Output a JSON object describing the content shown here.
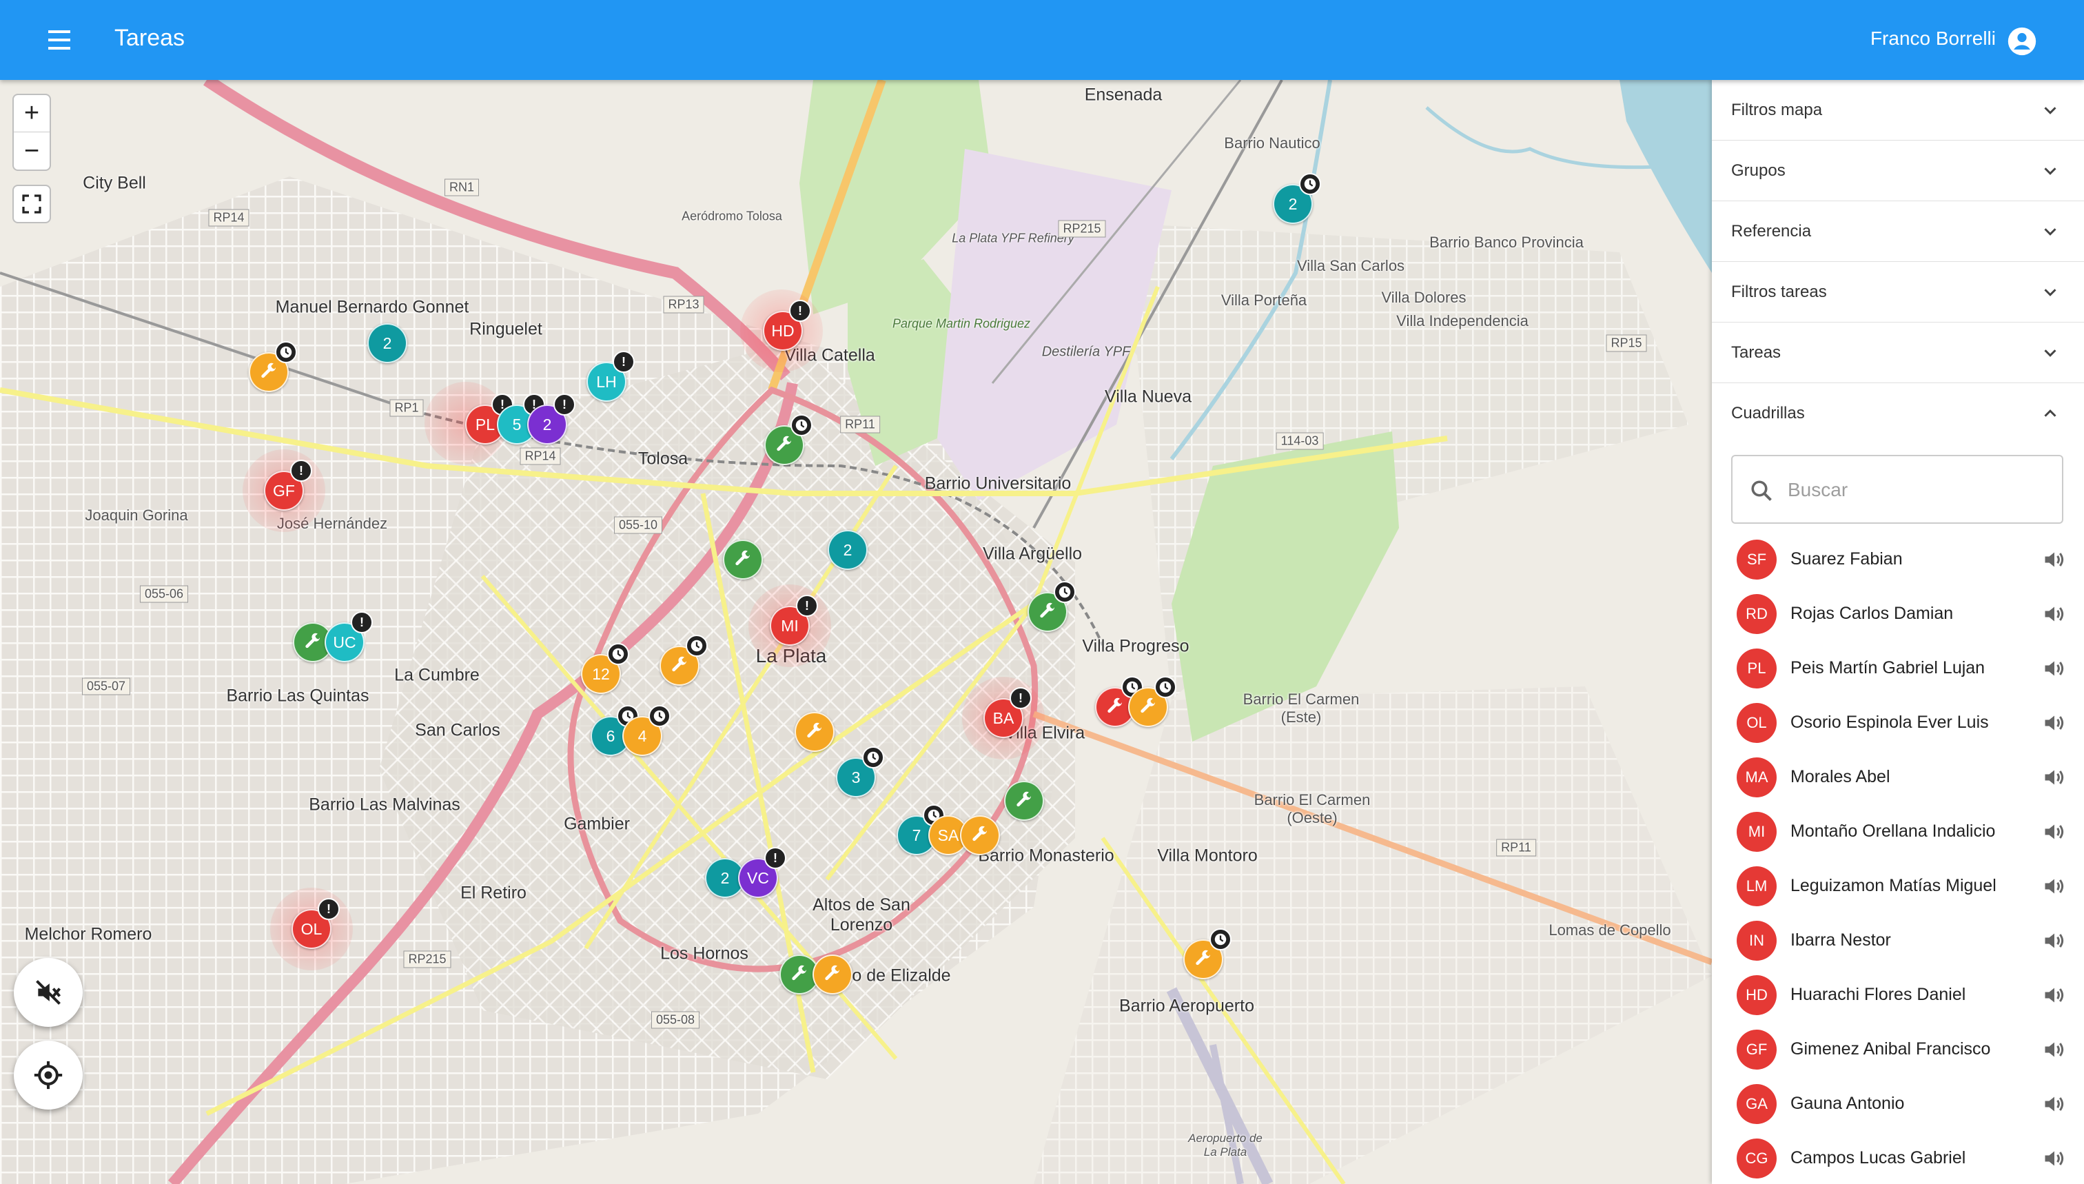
{
  "appbar": {
    "title": "Tareas",
    "user": "Franco Borrelli",
    "menu_icon": "menu-icon",
    "user_icon": "account-circle-icon"
  },
  "colors": {
    "appbar": "#2196f3",
    "red": "#e53935",
    "teal": "#0f9aa0",
    "cyan": "#1fbcc4",
    "purple": "#7b2fd1",
    "orange": "#f5a623",
    "green": "#43a047",
    "dark": "#222222"
  },
  "map": {
    "zoom_in": "+",
    "zoom_out": "−",
    "labels": {
      "ensenada": "Ensenada",
      "barrio_nautico": "Barrio Nautico",
      "city_bell": "City Bell",
      "aerodromo": "Aeródromo Tolosa",
      "refinery": "La Plata YPF Refinery",
      "parque": "Parque Martin Rodriguez",
      "destileria": "Destilería YPF",
      "barrio_banco": "Barrio Banco Provincia",
      "villa_san_carlos": "Villa San Carlos",
      "villa_portena": "Villa Porteña",
      "villa_dolores": "Villa Dolores",
      "villa_independencia": "Villa Independencia",
      "manuel_bernardo": "Manuel Bernardo Gonnet",
      "ringuelet": "Ringuelet",
      "villa_catella": "Villa Catella",
      "villa_nueva": "Villa Nueva",
      "tolosa": "Tolosa",
      "barrio_universitario": "Barrio Universitario",
      "villa_arguello": "Villa Argüello",
      "joaquin_gorina": "Joaquin Gorina",
      "jose_hernandez": "José Hernández",
      "la_plata": "La Plata",
      "villa_progreso": "Villa Progreso",
      "barrio_el_carmen_este": "Barrio El Carmen (Este)",
      "la_cumbre": "La Cumbre",
      "barrio_las_quintas": "Barrio Las Quintas",
      "san_carlos": "San Carlos",
      "villa_elvira": "Villa Elvira",
      "barrio_las_malvinas": "Barrio Las Malvinas",
      "gambier": "Gambier",
      "barrio_el_carmen_oeste": "Barrio El Carmen (Oeste)",
      "barrio_monasterio": "Barrio Monasterio",
      "villa_montoro": "Villa Montoro",
      "el_retiro": "El Retiro",
      "melchor_romero": "Melchor Romero",
      "altos_de_san_lorenzo": "Altos de San Lorenzo",
      "los_hornos": "Los Hornos",
      "de_elizalde": "o de Elizalde",
      "lomas_de_copello": "Lomas de Copello",
      "barrio_aeropuerto": "Barrio Aeropuerto",
      "aeropuerto": "Aeropuerto de La Plata"
    },
    "roads": {
      "rn1": "RN1",
      "rp14": "RP14",
      "rp13": "RP13",
      "rp215": "RP215",
      "rp15": "RP15",
      "rp1": "RP1",
      "rp14b": "RP14",
      "rp11": "RP11",
      "r11403": "114-03",
      "r05510": "055-10",
      "r05506": "055-06",
      "r05507": "055-07",
      "rp215b": "RP215",
      "r05508": "055-08",
      "rp11b": "RP11"
    },
    "markers": [
      {
        "text": "2",
        "color": "teal",
        "badge": "clock"
      },
      {
        "text": "HD",
        "color": "red",
        "badge": "alert"
      },
      {
        "text": "2",
        "color": "teal",
        "badge": ""
      },
      {
        "text": "",
        "color": "orange",
        "badge": "clock"
      },
      {
        "text": "LH",
        "color": "cyan",
        "badge": "alert"
      },
      {
        "text": "PL",
        "color": "red",
        "badge": "alert"
      },
      {
        "text": "5",
        "color": "cyan",
        "badge": "alert"
      },
      {
        "text": "2",
        "color": "purple",
        "badge": "alert"
      },
      {
        "text": "",
        "color": "green",
        "badge": "clock"
      },
      {
        "text": "GF",
        "color": "red",
        "badge": "alert"
      },
      {
        "text": "",
        "color": "green",
        "badge": ""
      },
      {
        "text": "2",
        "color": "teal",
        "badge": ""
      },
      {
        "text": "MI",
        "color": "red",
        "badge": "alert"
      },
      {
        "text": "",
        "color": "green",
        "badge": "clock"
      },
      {
        "text": "",
        "color": "green",
        "badge": ""
      },
      {
        "text": "UC",
        "color": "cyan",
        "badge": "alert"
      },
      {
        "text": "12",
        "color": "orange",
        "badge": "clock"
      },
      {
        "text": "",
        "color": "orange",
        "badge": "clock"
      },
      {
        "text": "BA",
        "color": "red",
        "badge": "alert"
      },
      {
        "text": "",
        "color": "red",
        "badge": "clock"
      },
      {
        "text": "",
        "color": "orange",
        "badge": "clock"
      },
      {
        "text": "6",
        "color": "teal",
        "badge": "clock"
      },
      {
        "text": "4",
        "color": "orange",
        "badge": "clock"
      },
      {
        "text": "",
        "color": "orange",
        "badge": ""
      },
      {
        "text": "3",
        "color": "teal",
        "badge": "clock"
      },
      {
        "text": "",
        "color": "green",
        "badge": ""
      },
      {
        "text": "7",
        "color": "teal",
        "badge": "clock"
      },
      {
        "text": "SA",
        "color": "orange",
        "badge": ""
      },
      {
        "text": "",
        "color": "orange",
        "badge": ""
      },
      {
        "text": "2",
        "color": "teal",
        "badge": ""
      },
      {
        "text": "VC",
        "color": "purple",
        "badge": "alert"
      },
      {
        "text": "OL",
        "color": "red",
        "badge": "alert"
      },
      {
        "text": "",
        "color": "orange",
        "badge": "clock"
      },
      {
        "text": "",
        "color": "green",
        "badge": ""
      },
      {
        "text": "",
        "color": "orange",
        "badge": ""
      }
    ]
  },
  "panel": {
    "sections": {
      "filtros_mapa": "Filtros mapa",
      "grupos": "Grupos",
      "referencia": "Referencia",
      "filtros_tareas": "Filtros tareas",
      "tareas": "Tareas",
      "cuadrillas": "Cuadrillas"
    },
    "search_placeholder": "Buscar",
    "crews": [
      {
        "initials": "SF",
        "name": "Suarez Fabian"
      },
      {
        "initials": "RD",
        "name": "Rojas Carlos Damian"
      },
      {
        "initials": "PL",
        "name": "Peis Martín Gabriel Lujan"
      },
      {
        "initials": "OL",
        "name": "Osorio Espinola Ever Luis"
      },
      {
        "initials": "MA",
        "name": "Morales Abel"
      },
      {
        "initials": "MI",
        "name": "Montaño Orellana Indalicio"
      },
      {
        "initials": "LM",
        "name": "Leguizamon Matías Miguel"
      },
      {
        "initials": "IN",
        "name": "Ibarra Nestor"
      },
      {
        "initials": "HD",
        "name": "Huarachi Flores Daniel"
      },
      {
        "initials": "GF",
        "name": "Gimenez Anibal Francisco"
      },
      {
        "initials": "GA",
        "name": "Gauna Antonio"
      },
      {
        "initials": "CG",
        "name": "Campos Lucas Gabriel"
      }
    ]
  }
}
